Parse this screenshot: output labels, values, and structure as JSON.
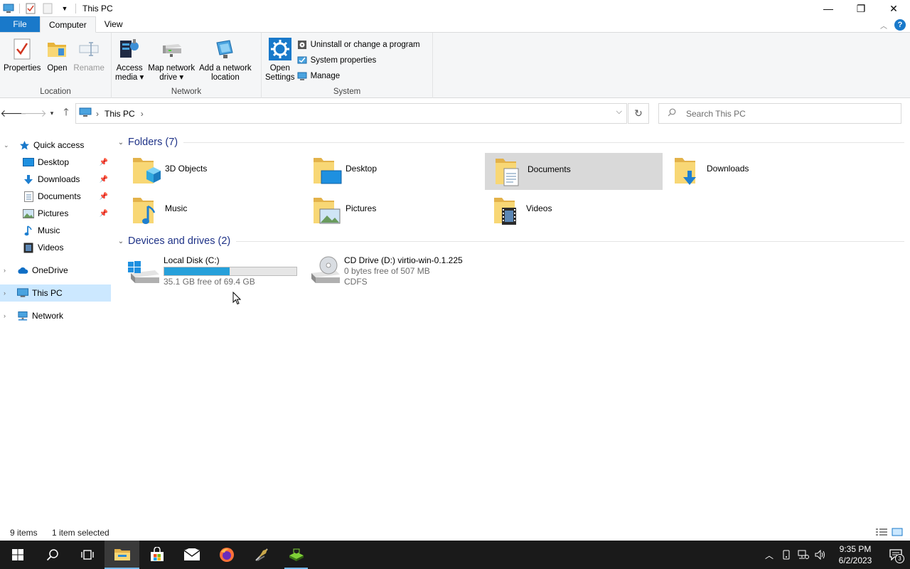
{
  "window": {
    "title": "This PC",
    "minimize_glyph": "—",
    "maximize_glyph": "❐",
    "close_glyph": "✕"
  },
  "ribbon_tabs": [
    {
      "label": "File"
    },
    {
      "label": "Computer"
    },
    {
      "label": "View"
    }
  ],
  "ribbon": {
    "location": {
      "label": "Location",
      "properties": "Properties",
      "open": "Open",
      "rename": "Rename"
    },
    "network": {
      "label": "Network",
      "access_media_1": "Access",
      "access_media_2": "media ▾",
      "map_drive_1": "Map network",
      "map_drive_2": "drive ▾",
      "add_location_1": "Add a network",
      "add_location_2": "location"
    },
    "system": {
      "label": "System",
      "open_settings_1": "Open",
      "open_settings_2": "Settings",
      "uninstall": "Uninstall or change a program",
      "system_properties": "System properties",
      "manage": "Manage"
    },
    "help_glyph": "?"
  },
  "address": {
    "crumb": "This PC",
    "search_placeholder": "Search This PC"
  },
  "nav_pane": {
    "quick_access": "Quick access",
    "quick_items": [
      {
        "label": "Desktop"
      },
      {
        "label": "Downloads"
      },
      {
        "label": "Documents"
      },
      {
        "label": "Pictures"
      },
      {
        "label": "Music"
      },
      {
        "label": "Videos"
      }
    ],
    "onedrive": "OneDrive",
    "this_pc": "This PC",
    "network": "Network"
  },
  "content": {
    "folders_header": "Folders (7)",
    "folders": [
      {
        "label": "3D Objects"
      },
      {
        "label": "Desktop"
      },
      {
        "label": "Documents"
      },
      {
        "label": "Downloads"
      },
      {
        "label": "Music"
      },
      {
        "label": "Pictures"
      },
      {
        "label": "Videos"
      }
    ],
    "devices_header": "Devices and drives (2)",
    "drives": [
      {
        "name": "Local Disk (C:)",
        "free": "35.1 GB free of 69.4 GB",
        "used_fraction": 0.494
      },
      {
        "name": "CD Drive (D:) virtio-win-0.1.225",
        "free": "0 bytes free of 507 MB",
        "fs": "CDFS"
      }
    ]
  },
  "status": {
    "items": "9 items",
    "selected": "1 item selected"
  },
  "taskbar": {
    "time": "9:35 PM",
    "date": "6/2/2023",
    "notification_count": "3"
  },
  "colors": {
    "accent": "#1979ca",
    "selection": "#cce8ff",
    "drive_bar": "#26a0da",
    "section_title": "#1e3287",
    "taskbar": "#1a1a1a"
  }
}
